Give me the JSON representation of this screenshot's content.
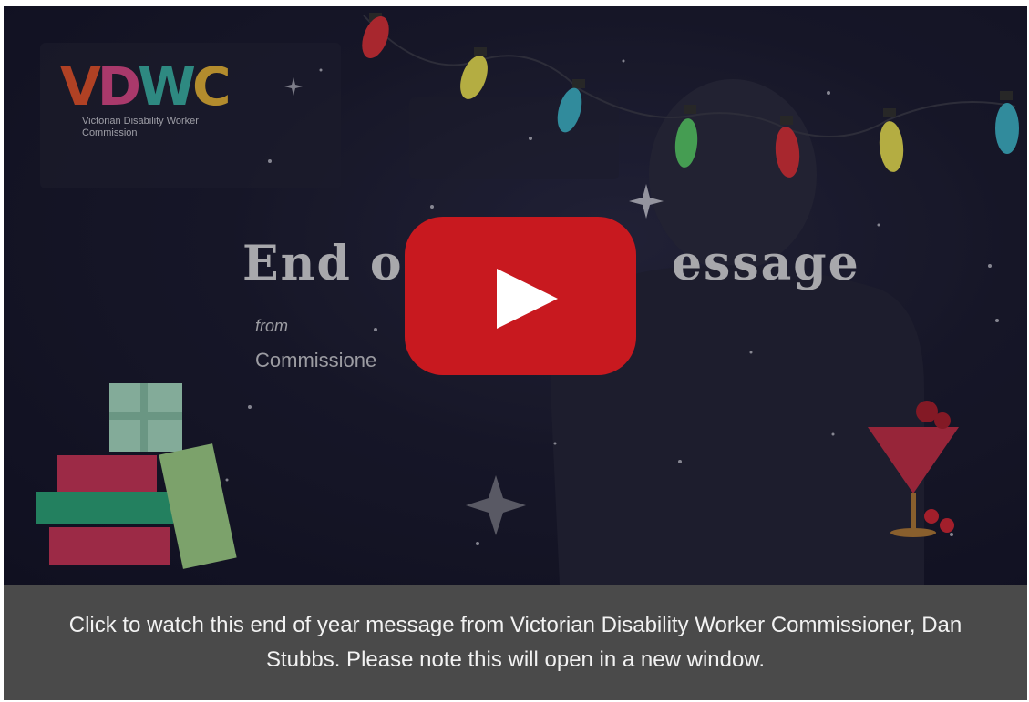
{
  "video": {
    "logo_text": "VDWC",
    "logo_subtitle": "Victorian Disability Worker Commission",
    "title_visible": "End of",
    "title_visible_right": "essage",
    "from_label": "from",
    "commissioner_partial": "Commissione",
    "play_icon": "youtube-play-icon",
    "accent_red": "#c8191f"
  },
  "caption": {
    "text": "Click to watch this end of year message from Victorian Disability Worker Commissioner, Dan Stubbs. Please note this will open in a new window."
  },
  "colors": {
    "caption_bg": "#4a4a4a",
    "caption_text": "#f2f2f2",
    "play_red": "#c8191f"
  }
}
